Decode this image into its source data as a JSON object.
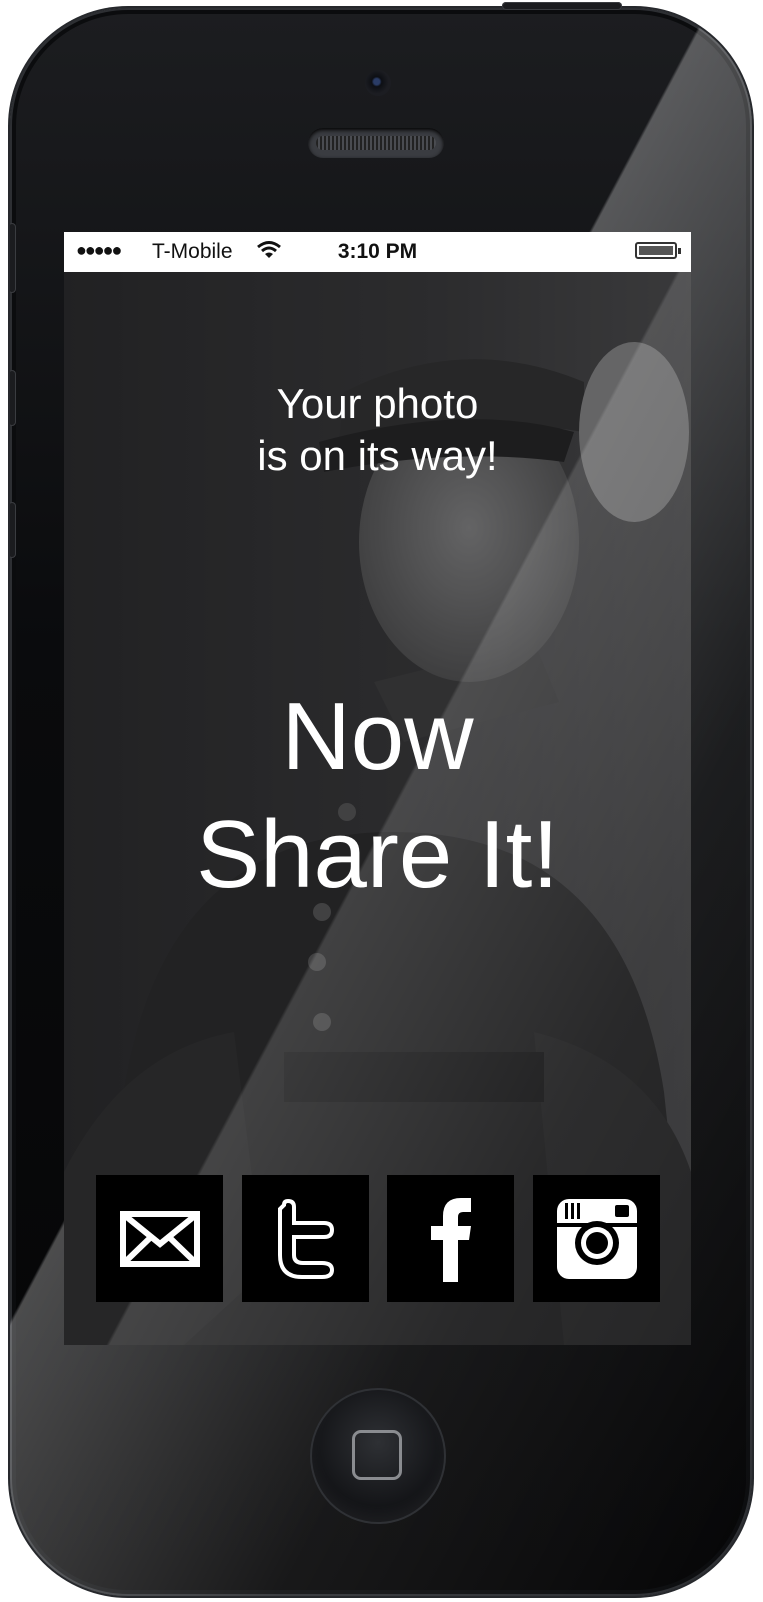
{
  "status_bar": {
    "signal": "●●●●●",
    "carrier": "T-Mobile",
    "wifi_icon": "wifi-icon",
    "time": "3:10 PM",
    "battery_icon": "battery-icon"
  },
  "content": {
    "subtitle_line1": "Your photo",
    "subtitle_line2": "is on its way!",
    "title_line1": "Now",
    "title_line2": "Share It!"
  },
  "share_buttons": [
    {
      "icon": "email-icon"
    },
    {
      "icon": "twitter-icon"
    },
    {
      "icon": "facebook-icon"
    },
    {
      "icon": "instagram-icon"
    }
  ],
  "colors": {
    "screen_text": "#ffffff",
    "share_button_bg": "#000000",
    "status_bar_bg": "#ffffff"
  }
}
